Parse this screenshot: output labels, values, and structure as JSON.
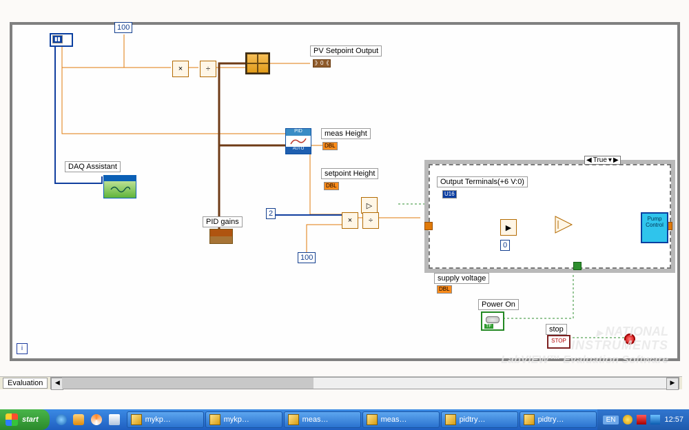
{
  "diagram": {
    "constants": {
      "c100_top": "100",
      "c2": "2",
      "c100_bot": "100",
      "c0": "0"
    },
    "labels": {
      "pv_setpoint_output": "PV Setpoint Output",
      "meas_height": "meas Height",
      "setpoint_height": "setpoint Height",
      "daq_assistant": "DAQ Assistant",
      "pid_gains": "PID gains",
      "output_terminals": "Output Terminals(+6 V:0)",
      "supply_voltage": "supply voltage",
      "power_on": "Power On",
      "stop": "stop",
      "pump_control": "Pump\nControl"
    },
    "pid_icon": {
      "top": "PID",
      "bottom": "AUTO"
    },
    "indicators": {
      "dbl": "DBL",
      "u16": "U16",
      "tf": "TF",
      "pos": "》0《"
    },
    "case_selector": {
      "left": "◀",
      "value": "True",
      "right": "▶",
      "down": "▾"
    },
    "stop_button": "STOP",
    "i_symbol": "i",
    "tunnel": "▶"
  },
  "watermark": {
    "line1": "NATIONAL",
    "line2": "INSTRUMENTS",
    "line3": "LabVIEW™ Evaluation Software"
  },
  "scrollrow": {
    "tab": "Evaluation",
    "left": "◀",
    "right": "▶"
  },
  "taskbar": {
    "start": "start",
    "tasks": [
      "mykp…",
      "mykp…",
      "meas…",
      "meas…",
      "pidtry…",
      "pidtry…"
    ],
    "lang": "EN",
    "clock": "12:57"
  }
}
